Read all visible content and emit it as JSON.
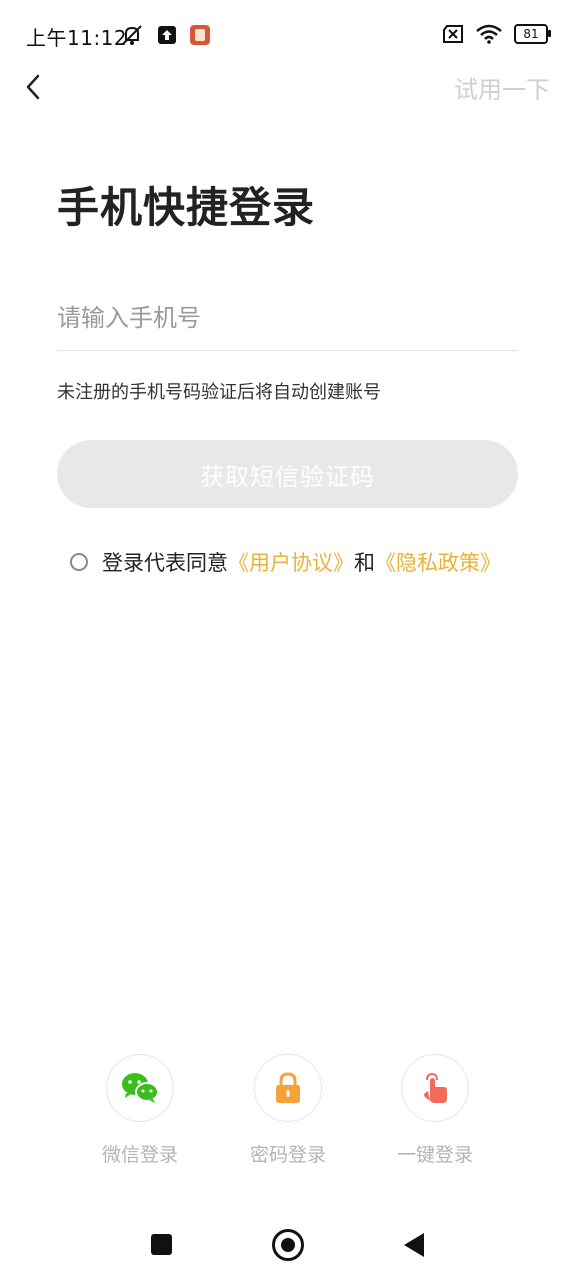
{
  "status_bar": {
    "time": "上午11:12",
    "battery": "81"
  },
  "header": {
    "back_icon": "chevron-left-icon",
    "trial_label": "试用一下"
  },
  "title": "手机快捷登录",
  "phone_field": {
    "placeholder": "请输入手机号",
    "value": ""
  },
  "hint": "未注册的手机号码验证后将自动创建账号",
  "sms_button": "获取短信验证码",
  "agreement": {
    "prefix": "登录代表同意",
    "user_agreement": "《用户协议》",
    "and": "和",
    "privacy_policy": "《隐私政策》",
    "checked": false
  },
  "login_options": [
    {
      "label": "微信登录",
      "icon": "wechat-icon",
      "color": "#3bbd1c"
    },
    {
      "label": "密码登录",
      "icon": "lock-icon",
      "color": "#f5a23a"
    },
    {
      "label": "一键登录",
      "icon": "tap-icon",
      "color": "#f26a5a"
    }
  ],
  "colors": {
    "accent_link": "#e9b23a",
    "button_disabled": "#e8e8e8"
  }
}
